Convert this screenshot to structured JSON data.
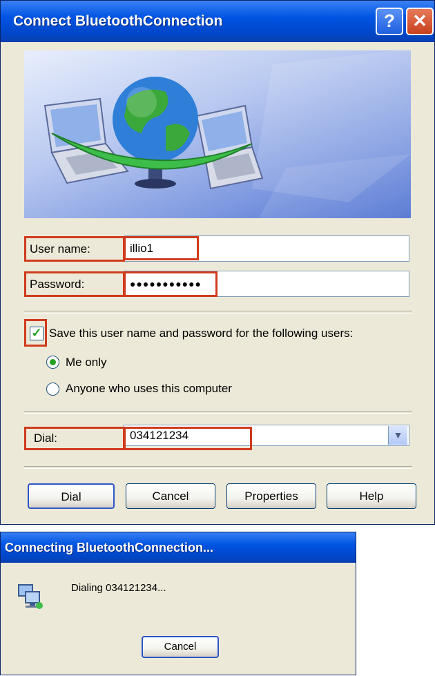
{
  "connect_dialog": {
    "title": "Connect BluetoothConnection",
    "help_glyph": "?",
    "close_glyph": "✕",
    "username_label": "User name:",
    "username_value": "illio1",
    "password_label": "Password:",
    "password_value": "●●●●●●●●●●●",
    "save_label": "Save this user name and password for the following users:",
    "save_checked": true,
    "radio_me_only": "Me only",
    "radio_anyone": "Anyone who uses this computer",
    "selected_radio": "Me only",
    "dial_label": "Dial:",
    "dial_value": "034121234",
    "buttons": {
      "dial": "Dial",
      "cancel": "Cancel",
      "properties": "Properties",
      "help": "Help"
    },
    "highlight_color": "#d03a1c"
  },
  "connecting_dialog": {
    "title": "Connecting BluetoothConnection...",
    "status_text": "Dialing 034121234...",
    "cancel_label": "Cancel"
  },
  "icons": {
    "banner": "network-globe-laptops-illustration",
    "status": "network-computers-icon",
    "combo": "chevron-down-icon"
  }
}
